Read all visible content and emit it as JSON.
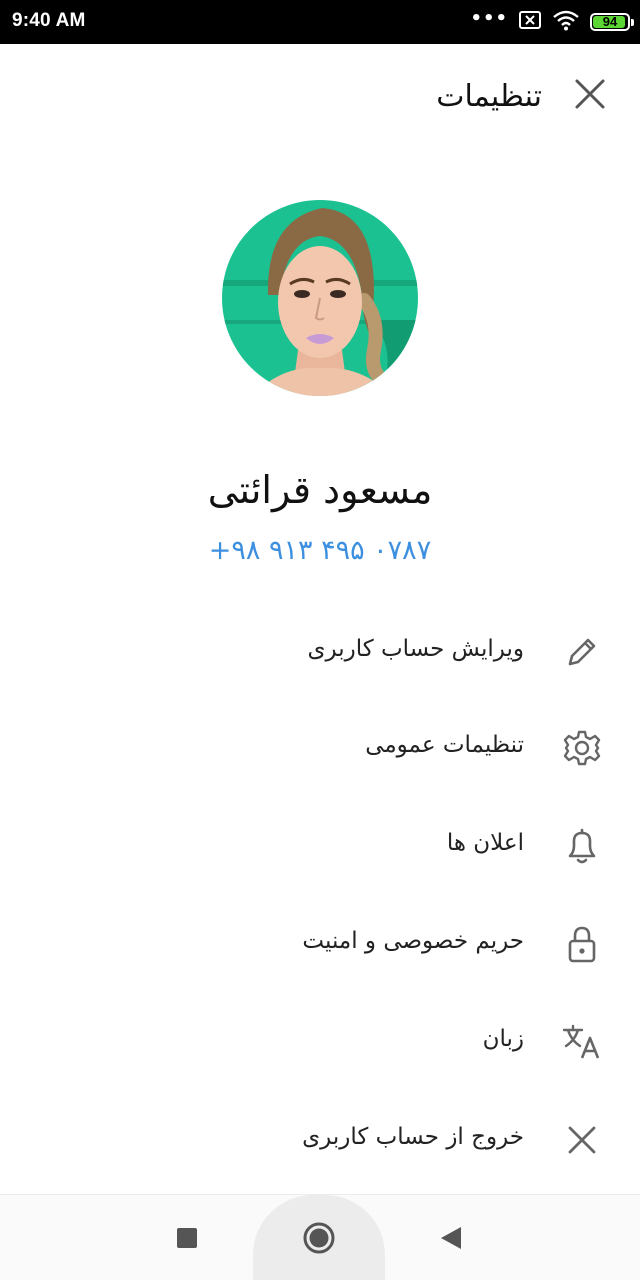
{
  "status_bar": {
    "time": "9:40 AM",
    "dots": "•••",
    "battery_level": "94",
    "battery_fraction": 0.94,
    "battery_color": "#5cd632"
  },
  "header": {
    "title": "تنظیمات",
    "close_icon": "close-icon"
  },
  "profile": {
    "name": "مسعود قرائتی",
    "phone": "+۹۸ ۹۱۳ ۴۹۵ ۰۷۸۷",
    "avatar_bg": "#1cc191"
  },
  "menu": {
    "items": [
      {
        "label": "ویرایش حساب کاربری",
        "icon": "pencil-icon"
      },
      {
        "label": "تنظیمات عمومی",
        "icon": "gear-icon"
      },
      {
        "label": "اعلان ها",
        "icon": "bell-icon"
      },
      {
        "label": "حریم خصوصی و امنیت",
        "icon": "lock-icon"
      },
      {
        "label": "زبان",
        "icon": "translate-icon"
      },
      {
        "label": "خروج از حساب کاربری",
        "icon": "close-icon"
      }
    ]
  },
  "nav_bar": {
    "buttons": [
      "recents-icon",
      "home-icon",
      "back-icon"
    ]
  },
  "colors": {
    "accent": "#3d8fe0",
    "icon": "#666666",
    "text": "#222222"
  }
}
